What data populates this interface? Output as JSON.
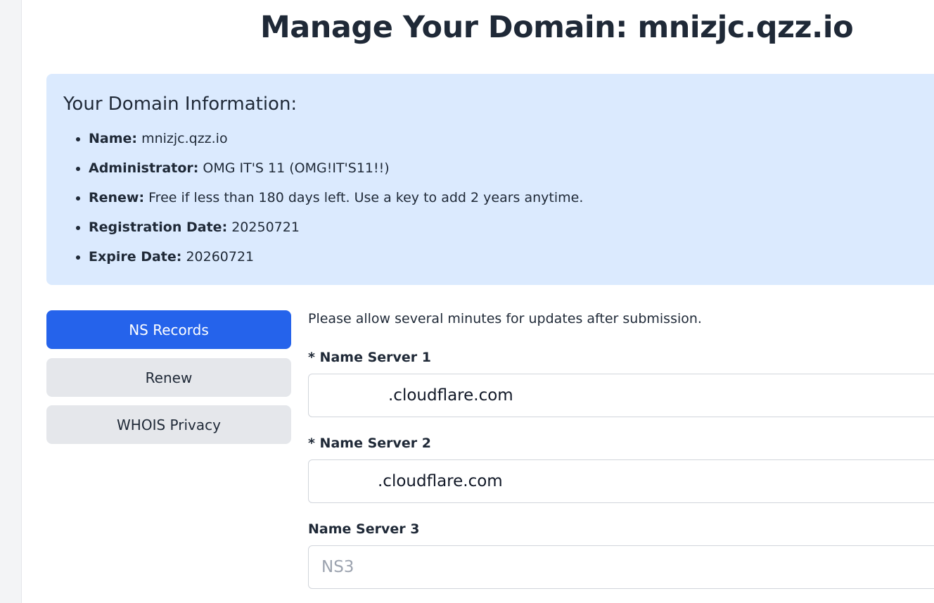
{
  "page": {
    "title": "Manage Your Domain: mnizjc.qzz.io"
  },
  "domain_info": {
    "heading": "Your Domain Information:",
    "items": [
      {
        "label": "Name:",
        "value": "mnizjc.qzz.io"
      },
      {
        "label": "Administrator:",
        "value": "OMG IT'S 11 (OMG!IT'S11!!)"
      },
      {
        "label": "Renew:",
        "value": "Free if less than 180 days left. Use a key to add 2 years anytime."
      },
      {
        "label": "Registration Date:",
        "value": "20250721"
      },
      {
        "label": "Expire Date:",
        "value": "20260721"
      }
    ]
  },
  "tabs": [
    {
      "label": "NS Records",
      "active": true
    },
    {
      "label": "Renew",
      "active": false
    },
    {
      "label": "WHOIS Privacy",
      "active": false
    }
  ],
  "ns_form": {
    "notice": "Please allow several minutes for updates after submission.",
    "fields": [
      {
        "label": "* Name Server 1",
        "value": ".cloudflare.com",
        "placeholder": ""
      },
      {
        "label": "* Name Server 2",
        "value": ".cloudflare.com",
        "placeholder": ""
      },
      {
        "label": "Name Server 3",
        "value": "",
        "placeholder": "NS3"
      }
    ]
  },
  "colors": {
    "primary": "#2563eb",
    "info_panel_bg": "#dbeafe",
    "inactive_tab_bg": "#e5e7eb",
    "text": "#1f2937"
  }
}
